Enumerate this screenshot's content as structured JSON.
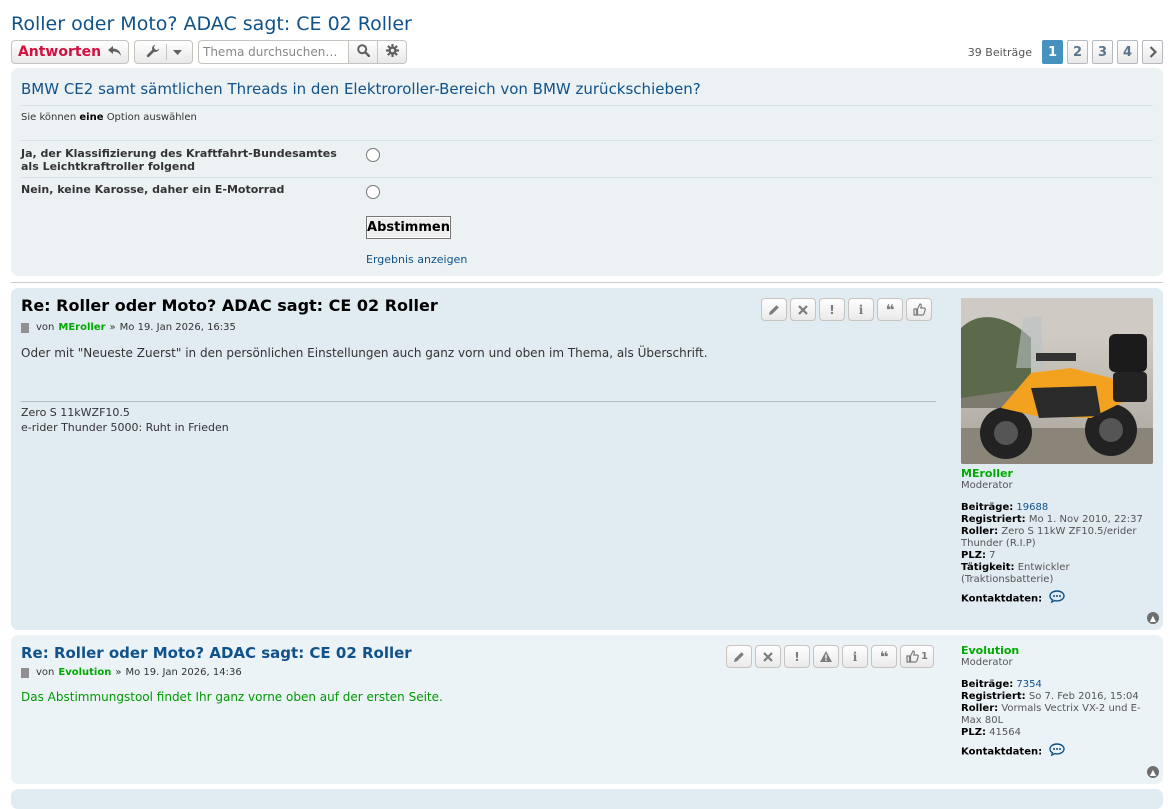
{
  "topic": {
    "title": "Roller oder Moto? ADAC sagt: CE 02 Roller"
  },
  "action_bar": {
    "reply_label": "Antworten",
    "search_placeholder": "Thema durchsuchen…",
    "post_count": "39 Beiträge",
    "pages": [
      "1",
      "2",
      "3",
      "4"
    ],
    "active_page": "1"
  },
  "poll": {
    "question": "BMW CE2 samt sämtlichen Threads in den Elektroroller-Bereich von BMW zurückschieben?",
    "hint_prefix": "Sie können",
    "hint_bold": "eine",
    "hint_suffix": "Option auswählen",
    "options": [
      "Ja, der Klassifizierung des Kraftfahrt-Bundesamtes als Leichtkraftroller folgend",
      "Nein, keine Karosse, daher ein E-Motorrad"
    ],
    "vote_label": "Abstimmen",
    "results_label": "Ergebnis anzeigen"
  },
  "posts": [
    {
      "title": "Re: Roller oder Moto? ADAC sagt: CE 02 Roller",
      "by": "von",
      "author": "MEroller",
      "sep": "»",
      "date": "Mo 19. Jan 2026, 16:35",
      "body": "Oder mit \"Neueste Zuerst\" in den persönlichen Einstellungen auch ganz vorn und oben im Thema, als Überschrift.",
      "signature": [
        "Zero S 11kWZF10.5",
        "e-rider Thunder 5000: Ruht in Frieden"
      ],
      "profile": {
        "name": "MEroller",
        "rank": "Moderator",
        "posts_label": "Beiträge:",
        "posts": "19688",
        "registered_label": "Registriert:",
        "registered": "Mo 1. Nov 2010, 22:37",
        "roller_label": "Roller:",
        "roller": "Zero S 11kW ZF10.5/erider Thunder (R.I.P)",
        "plz_label": "PLZ:",
        "plz": "7",
        "job_label": "Tätigkeit:",
        "job": "Entwickler (Traktionsbatterie)",
        "contact_label": "Kontaktdaten:"
      }
    },
    {
      "title": "Re: Roller oder Moto? ADAC sagt: CE 02 Roller",
      "by": "von",
      "author": "Evolution",
      "sep": "»",
      "date": "Mo 19. Jan 2026, 14:36",
      "body": "Das Abstimmungstool findet Ihr ganz vorne oben auf der ersten Seite.",
      "like_count": "1",
      "profile": {
        "name": "Evolution",
        "rank": "Moderator",
        "posts_label": "Beiträge:",
        "posts": "7354",
        "registered_label": "Registriert:",
        "registered": "So 7. Feb 2016, 15:04",
        "roller_label": "Roller:",
        "roller": "Vormals Vectrix VX-2 und E-Max 80L",
        "plz_label": "PLZ:",
        "plz": "41564",
        "contact_label": "Kontaktdaten:"
      }
    }
  ],
  "colors": {
    "reply_red": "#d31141",
    "link_blue": "#105289",
    "moderator_green": "#00aa00",
    "post_bg_dark": "#e1ebf2",
    "post_bg_light": "#ecf3f7",
    "poll_bg": "#ecf1f3",
    "active_page": "#4692bf"
  },
  "icons": {
    "reply": "reply-arrow-icon",
    "tools": "wrench-icon",
    "search": "magnifier-icon",
    "advanced_search": "gear-icon",
    "edit": "pencil-icon",
    "delete": "x-icon",
    "report": "exclamation-icon",
    "warn": "warning-triangle-icon",
    "info": "info-icon",
    "quote": "quote-icon",
    "like": "thumbs-up-icon",
    "contact": "speech-bubble-icon",
    "top": "arrow-up-icon"
  }
}
